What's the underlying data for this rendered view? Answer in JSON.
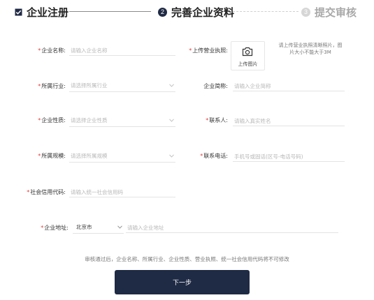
{
  "steps": [
    {
      "label": "企业注册",
      "state": "done"
    },
    {
      "label": "完善企业资料",
      "number": "2",
      "state": "active"
    },
    {
      "label": "提交审核",
      "number": "3",
      "state": "pending"
    }
  ],
  "colors": {
    "primary": "#1f2a44",
    "required": "#e23b3b",
    "placeholder": "#b8b8b8"
  },
  "form": {
    "company_name": {
      "label": "企业名称:",
      "required": true,
      "placeholder": "请输入企业名称"
    },
    "license": {
      "label": "上传营业执照:",
      "required": true,
      "upload_label": "上传图片",
      "hint": "请上传营业执照清晰照片，图片大小不能大于3M"
    },
    "industry": {
      "label": "所属行业:",
      "required": true,
      "placeholder": "请选择所属行业"
    },
    "short_name": {
      "label": "企业简称:",
      "required": false,
      "placeholder": "请输入企业简称"
    },
    "nature": {
      "label": "企业性质:",
      "required": true,
      "placeholder": "请选择企业性质"
    },
    "contact": {
      "label": "联系人:",
      "required": true,
      "placeholder": "请输入真实姓名"
    },
    "scale": {
      "label": "所属规模:",
      "required": true,
      "placeholder": "请选择所属规模"
    },
    "phone": {
      "label": "联系电话:",
      "required": true,
      "placeholder": "手机号或固话(区号-电话号码)"
    },
    "credit_code": {
      "label": "社会信用代码:",
      "required": true,
      "placeholder": "请输入统一社会信用码"
    },
    "address": {
      "label": "企业地址:",
      "required": true,
      "city": "北京市",
      "placeholder": "请输入企业地址"
    }
  },
  "notice": "审核通过后，企业名称、所属行业、企业性质、营业执照、统一社会信用代码将不可修改",
  "next_button": "下一步"
}
